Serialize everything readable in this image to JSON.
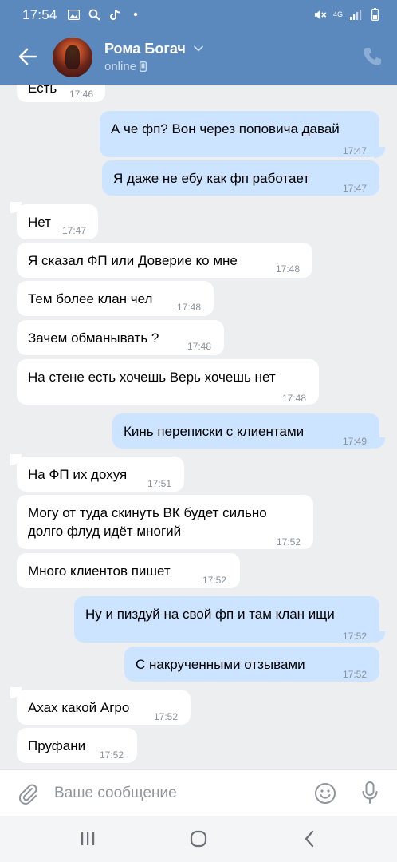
{
  "status_bar": {
    "time": "17:54",
    "network": "4G"
  },
  "header": {
    "contact_name": "Рома Богач",
    "contact_status": "online"
  },
  "messages": [
    {
      "dir": "in",
      "text": "Есть",
      "time": "17:46"
    },
    {
      "dir": "out",
      "text": "А че фп? Вон через поповича давай",
      "time": "17:47"
    },
    {
      "dir": "out",
      "text": "Я даже не ебу как фп работает",
      "time": "17:47"
    },
    {
      "dir": "in",
      "text": "Нет",
      "time": "17:47"
    },
    {
      "dir": "in",
      "text": "Я сказал ФП или Доверие ко мне",
      "time": "17:48"
    },
    {
      "dir": "in",
      "text": "Тем более клан чел",
      "time": "17:48"
    },
    {
      "dir": "in",
      "text": "Зачем обманывать ?",
      "time": "17:48"
    },
    {
      "dir": "in",
      "text": "На стене есть хочешь Верь хочешь нет",
      "time": "17:48"
    },
    {
      "dir": "out",
      "text": "Кинь переписки с клиентами",
      "time": "17:49"
    },
    {
      "dir": "in",
      "text": "На ФП их дохуя",
      "time": "17:51"
    },
    {
      "dir": "in",
      "text": "Могу от туда скинуть ВК будет сильно долго флуд идёт многий",
      "time": "17:52"
    },
    {
      "dir": "in",
      "text": "Много клиентов пишет",
      "time": "17:52"
    },
    {
      "dir": "out",
      "text": "Ну и пиздуй на свой фп и там клан ищи",
      "time": "17:52"
    },
    {
      "dir": "out",
      "text": "С накрученными отзывами",
      "time": "17:52"
    },
    {
      "dir": "in",
      "text": "Ахах какой Агро",
      "time": "17:52"
    },
    {
      "dir": "in",
      "text": "Пруфани",
      "time": "17:52"
    }
  ],
  "input": {
    "placeholder": "Ваше сообщение"
  },
  "colors": {
    "header": "#5b88bd",
    "incoming_bubble": "#ffffff",
    "outgoing_bubble": "#cce4ff",
    "chat_background": "#edeef0"
  }
}
